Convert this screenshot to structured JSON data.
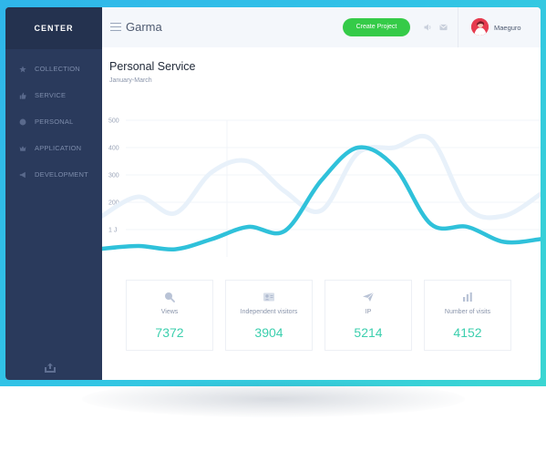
{
  "brand": {
    "name": "CENTER"
  },
  "sidebar": {
    "items": [
      {
        "label": "COLLECTION",
        "icon": "star-icon"
      },
      {
        "label": "SERVICE",
        "icon": "thumbs-up-icon"
      },
      {
        "label": "PERSONAL",
        "icon": "user-icon"
      },
      {
        "label": "APPLICATION",
        "icon": "crown-icon"
      },
      {
        "label": "DEVELOPMENT",
        "icon": "megaphone-icon"
      }
    ],
    "bottom_icon": "export-icon"
  },
  "topbar": {
    "title": "Garma",
    "create_button": "Create Project",
    "icons": [
      "volume-icon",
      "mail-icon"
    ],
    "user": {
      "name": "Maeguro"
    }
  },
  "main": {
    "title": "Personal Service",
    "subtitle": "January-March"
  },
  "chart_data": {
    "type": "line",
    "y_ticks": [
      "500",
      "400",
      "300",
      "200",
      "1 J"
    ],
    "ylim": [
      0,
      500
    ],
    "grid": true,
    "series": [
      {
        "color": "#2fc1da",
        "values": [
          30,
          40,
          28,
          65,
          110,
          95,
          280,
          400,
          330,
          120,
          110,
          55,
          65
        ]
      },
      {
        "color": "#e8f1fa",
        "values": [
          150,
          220,
          160,
          310,
          350,
          240,
          170,
          380,
          400,
          430,
          180,
          150,
          230
        ]
      }
    ]
  },
  "stats": [
    {
      "label": "Views",
      "value": "7372",
      "icon": "search-icon"
    },
    {
      "label": "Independent visitors",
      "value": "3904",
      "icon": "id-card-icon"
    },
    {
      "label": "IP",
      "value": "5214",
      "icon": "paper-plane-icon"
    },
    {
      "label": "Number of visits",
      "value": "4152",
      "icon": "bar-chart-icon"
    }
  ],
  "colors": {
    "accent": "#2fc1da",
    "sidebar": "#2a3a5c",
    "button": "#35cb48",
    "stat_value": "#3ccfae"
  }
}
